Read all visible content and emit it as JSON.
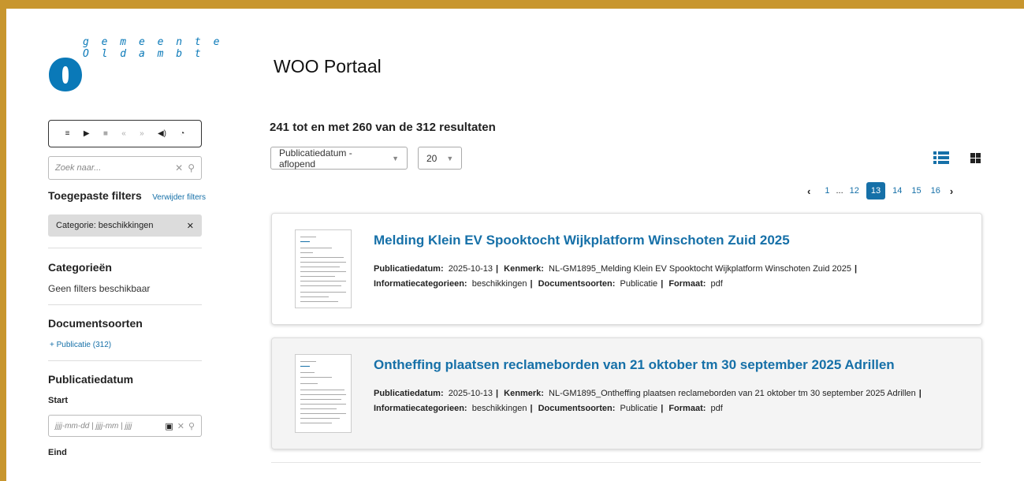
{
  "brand": {
    "name_line1": "g e m e e n t e",
    "name_line2": "O l d a m b t",
    "color": "#0a79b8",
    "frame_color": "#c8962e"
  },
  "player": {
    "buttons": [
      "menu-icon",
      "play-icon",
      "stop-icon",
      "rewind-icon",
      "fast-forward-icon",
      "volume-icon",
      "speed-icon"
    ],
    "glyphs": [
      "≡",
      "▶",
      "■",
      "«",
      "»",
      "◀)",
      "◔"
    ]
  },
  "sidebar": {
    "search_placeholder": "Zoek naar...",
    "applied_filters_title": "Toegepaste filters",
    "remove_filters_label": "Verwijder filters",
    "active_filter": "Categorie: beschikkingen",
    "categories_title": "Categorieën",
    "categories_empty": "Geen filters beschikbaar",
    "doctypes_title": "Documentsoorten",
    "doctype_item": "+  Publicatie (312)",
    "pubdate_title": "Publicatiedatum",
    "start_label": "Start",
    "date_placeholder": "jjjj-mm-dd | jjjj-mm | jjjj",
    "end_label": "Eind"
  },
  "main": {
    "page_title": "WOO Portaal",
    "results_text": "241 tot en met 260 van de 312 resultaten",
    "sort_value": "Publicatiedatum - aflopend",
    "page_size_value": "20",
    "pagination": [
      "1",
      "...",
      "12",
      "13",
      "14",
      "15",
      "16"
    ],
    "current_page": "13"
  },
  "labels": {
    "pubdate": "Publicatiedatum:",
    "kenmerk": "Kenmerk:",
    "infocat": "Informatiecategorieen:",
    "doctype": "Documentsoorten:",
    "format": "Formaat:"
  },
  "documents": [
    {
      "title": "Melding Klein EV Spooktocht Wijkplatform Winschoten Zuid 2025",
      "date": "2025-10-13",
      "kenmerk": "NL-GM1895_Melding Klein EV Spooktocht Wijkplatform Winschoten Zuid 2025",
      "category": "beschikkingen",
      "doctype": "Publicatie",
      "format": "pdf"
    },
    {
      "title": "Ontheffing plaatsen reclameborden van 21 oktober tm 30 september 2025 Adrillen",
      "date": "2025-10-13",
      "kenmerk": "NL-GM1895_Ontheffing plaatsen reclameborden van 21 oktober tm 30 september 2025 Adrillen",
      "category": "beschikkingen",
      "doctype": "Publicatie",
      "format": "pdf"
    }
  ]
}
